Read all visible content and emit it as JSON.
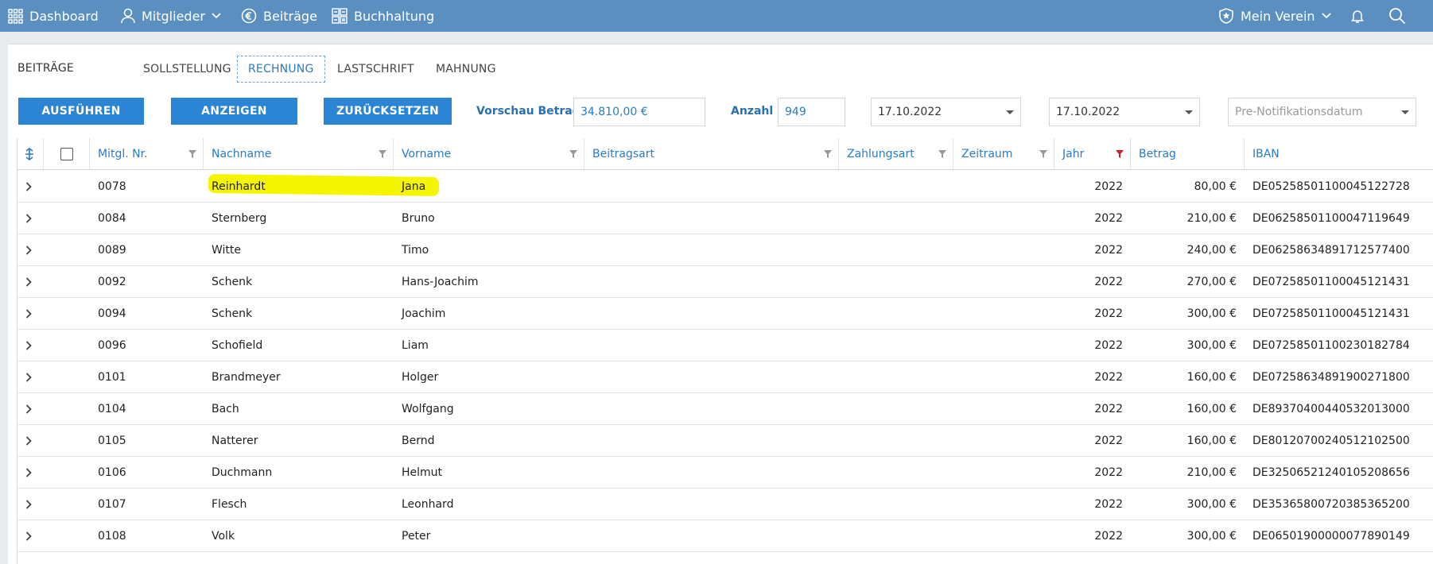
{
  "nav": {
    "dashboard": "Dashboard",
    "mitglieder": "Mitglieder",
    "beitraege": "Beiträge",
    "buchhaltung": "Buchhaltung",
    "verein": "Mein Verein"
  },
  "section_label": "BEITRÄGE",
  "tabs": [
    {
      "label": "SOLLSTELLUNG"
    },
    {
      "label": "RECHNUNG"
    },
    {
      "label": "LASTSCHRIFT"
    },
    {
      "label": "MAHNUNG"
    }
  ],
  "actions": {
    "ausfuehren": "AUSFÜHREN",
    "anzeigen": "ANZEIGEN",
    "zuruecksetzen": "ZURÜCKSETZEN"
  },
  "preview": {
    "betrag_label": "Vorschau Betrag",
    "betrag_value": "34.810,00 €",
    "anzahl_label": "Anzahl",
    "anzahl_value": "949",
    "date1": "17.10.2022",
    "date2": "17.10.2022",
    "prenotification_placeholder": "Pre-Notifikationsdatum"
  },
  "columns": {
    "mitgl_nr": "Mitgl. Nr.",
    "nachname": "Nachname",
    "vorname": "Vorname",
    "beitragsart": "Beitragsart",
    "zahlungsart": "Zahlungsart",
    "zeitraum": "Zeitraum",
    "jahr": "Jahr",
    "betrag": "Betrag",
    "iban": "IBAN"
  },
  "rows": [
    {
      "nr": "0078",
      "nachname": "Reinhardt",
      "vorname": "Jana",
      "jahr": "2022",
      "betrag": "80,00 €",
      "iban": "DE05258501100045122728"
    },
    {
      "nr": "0084",
      "nachname": "Sternberg",
      "vorname": "Bruno",
      "jahr": "2022",
      "betrag": "210,00 €",
      "iban": "DE06258501100047119649"
    },
    {
      "nr": "0089",
      "nachname": "Witte",
      "vorname": "Timo",
      "jahr": "2022",
      "betrag": "240,00 €",
      "iban": "DE06258634891712577400"
    },
    {
      "nr": "0092",
      "nachname": "Schenk",
      "vorname": "Hans-Joachim",
      "jahr": "2022",
      "betrag": "270,00 €",
      "iban": "DE07258501100045121431"
    },
    {
      "nr": "0094",
      "nachname": "Schenk",
      "vorname": "Joachim",
      "jahr": "2022",
      "betrag": "300,00 €",
      "iban": "DE07258501100045121431"
    },
    {
      "nr": "0096",
      "nachname": "Schofield",
      "vorname": "Liam",
      "jahr": "2022",
      "betrag": "300,00 €",
      "iban": "DE07258501100230182784"
    },
    {
      "nr": "0101",
      "nachname": "Brandmeyer",
      "vorname": "Holger",
      "jahr": "2022",
      "betrag": "160,00 €",
      "iban": "DE07258634891900271800"
    },
    {
      "nr": "0104",
      "nachname": "Bach",
      "vorname": "Wolfgang",
      "jahr": "2022",
      "betrag": "160,00 €",
      "iban": "DE89370400440532013000"
    },
    {
      "nr": "0105",
      "nachname": "Natterer",
      "vorname": "Bernd",
      "jahr": "2022",
      "betrag": "160,00 €",
      "iban": "DE80120700240512102500"
    },
    {
      "nr": "0106",
      "nachname": "Duchmann",
      "vorname": "Helmut",
      "jahr": "2022",
      "betrag": "210,00 €",
      "iban": "DE32506521240105208656"
    },
    {
      "nr": "0107",
      "nachname": "Flesch",
      "vorname": "Leonhard",
      "jahr": "2022",
      "betrag": "300,00 €",
      "iban": "DE35365800720385365200"
    },
    {
      "nr": "0108",
      "nachname": "Volk",
      "vorname": "Peter",
      "jahr": "2022",
      "betrag": "300,00 €",
      "iban": "DE06501900000077890149"
    }
  ],
  "colors": {
    "nav_bg": "#5b8fc0",
    "accent": "#2b84d4",
    "link_text": "#2a7bc4",
    "highlight": "#f5f500",
    "active_filter": "#d0202a"
  }
}
